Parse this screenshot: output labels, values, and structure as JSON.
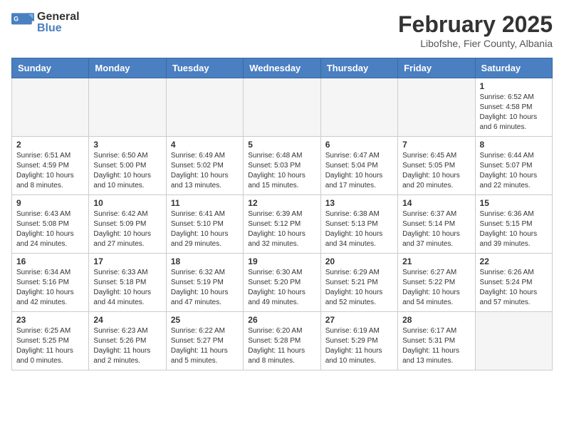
{
  "header": {
    "logo_general": "General",
    "logo_blue": "Blue",
    "title": "February 2025",
    "subtitle": "Libofshe, Fier County, Albania"
  },
  "calendar": {
    "days_of_week": [
      "Sunday",
      "Monday",
      "Tuesday",
      "Wednesday",
      "Thursday",
      "Friday",
      "Saturday"
    ],
    "weeks": [
      [
        {
          "day": "",
          "info": ""
        },
        {
          "day": "",
          "info": ""
        },
        {
          "day": "",
          "info": ""
        },
        {
          "day": "",
          "info": ""
        },
        {
          "day": "",
          "info": ""
        },
        {
          "day": "",
          "info": ""
        },
        {
          "day": "1",
          "info": "Sunrise: 6:52 AM\nSunset: 4:58 PM\nDaylight: 10 hours and 6 minutes."
        }
      ],
      [
        {
          "day": "2",
          "info": "Sunrise: 6:51 AM\nSunset: 4:59 PM\nDaylight: 10 hours and 8 minutes."
        },
        {
          "day": "3",
          "info": "Sunrise: 6:50 AM\nSunset: 5:00 PM\nDaylight: 10 hours and 10 minutes."
        },
        {
          "day": "4",
          "info": "Sunrise: 6:49 AM\nSunset: 5:02 PM\nDaylight: 10 hours and 13 minutes."
        },
        {
          "day": "5",
          "info": "Sunrise: 6:48 AM\nSunset: 5:03 PM\nDaylight: 10 hours and 15 minutes."
        },
        {
          "day": "6",
          "info": "Sunrise: 6:47 AM\nSunset: 5:04 PM\nDaylight: 10 hours and 17 minutes."
        },
        {
          "day": "7",
          "info": "Sunrise: 6:45 AM\nSunset: 5:05 PM\nDaylight: 10 hours and 20 minutes."
        },
        {
          "day": "8",
          "info": "Sunrise: 6:44 AM\nSunset: 5:07 PM\nDaylight: 10 hours and 22 minutes."
        }
      ],
      [
        {
          "day": "9",
          "info": "Sunrise: 6:43 AM\nSunset: 5:08 PM\nDaylight: 10 hours and 24 minutes."
        },
        {
          "day": "10",
          "info": "Sunrise: 6:42 AM\nSunset: 5:09 PM\nDaylight: 10 hours and 27 minutes."
        },
        {
          "day": "11",
          "info": "Sunrise: 6:41 AM\nSunset: 5:10 PM\nDaylight: 10 hours and 29 minutes."
        },
        {
          "day": "12",
          "info": "Sunrise: 6:39 AM\nSunset: 5:12 PM\nDaylight: 10 hours and 32 minutes."
        },
        {
          "day": "13",
          "info": "Sunrise: 6:38 AM\nSunset: 5:13 PM\nDaylight: 10 hours and 34 minutes."
        },
        {
          "day": "14",
          "info": "Sunrise: 6:37 AM\nSunset: 5:14 PM\nDaylight: 10 hours and 37 minutes."
        },
        {
          "day": "15",
          "info": "Sunrise: 6:36 AM\nSunset: 5:15 PM\nDaylight: 10 hours and 39 minutes."
        }
      ],
      [
        {
          "day": "16",
          "info": "Sunrise: 6:34 AM\nSunset: 5:16 PM\nDaylight: 10 hours and 42 minutes."
        },
        {
          "day": "17",
          "info": "Sunrise: 6:33 AM\nSunset: 5:18 PM\nDaylight: 10 hours and 44 minutes."
        },
        {
          "day": "18",
          "info": "Sunrise: 6:32 AM\nSunset: 5:19 PM\nDaylight: 10 hours and 47 minutes."
        },
        {
          "day": "19",
          "info": "Sunrise: 6:30 AM\nSunset: 5:20 PM\nDaylight: 10 hours and 49 minutes."
        },
        {
          "day": "20",
          "info": "Sunrise: 6:29 AM\nSunset: 5:21 PM\nDaylight: 10 hours and 52 minutes."
        },
        {
          "day": "21",
          "info": "Sunrise: 6:27 AM\nSunset: 5:22 PM\nDaylight: 10 hours and 54 minutes."
        },
        {
          "day": "22",
          "info": "Sunrise: 6:26 AM\nSunset: 5:24 PM\nDaylight: 10 hours and 57 minutes."
        }
      ],
      [
        {
          "day": "23",
          "info": "Sunrise: 6:25 AM\nSunset: 5:25 PM\nDaylight: 11 hours and 0 minutes."
        },
        {
          "day": "24",
          "info": "Sunrise: 6:23 AM\nSunset: 5:26 PM\nDaylight: 11 hours and 2 minutes."
        },
        {
          "day": "25",
          "info": "Sunrise: 6:22 AM\nSunset: 5:27 PM\nDaylight: 11 hours and 5 minutes."
        },
        {
          "day": "26",
          "info": "Sunrise: 6:20 AM\nSunset: 5:28 PM\nDaylight: 11 hours and 8 minutes."
        },
        {
          "day": "27",
          "info": "Sunrise: 6:19 AM\nSunset: 5:29 PM\nDaylight: 11 hours and 10 minutes."
        },
        {
          "day": "28",
          "info": "Sunrise: 6:17 AM\nSunset: 5:31 PM\nDaylight: 11 hours and 13 minutes."
        },
        {
          "day": "",
          "info": ""
        }
      ]
    ]
  }
}
